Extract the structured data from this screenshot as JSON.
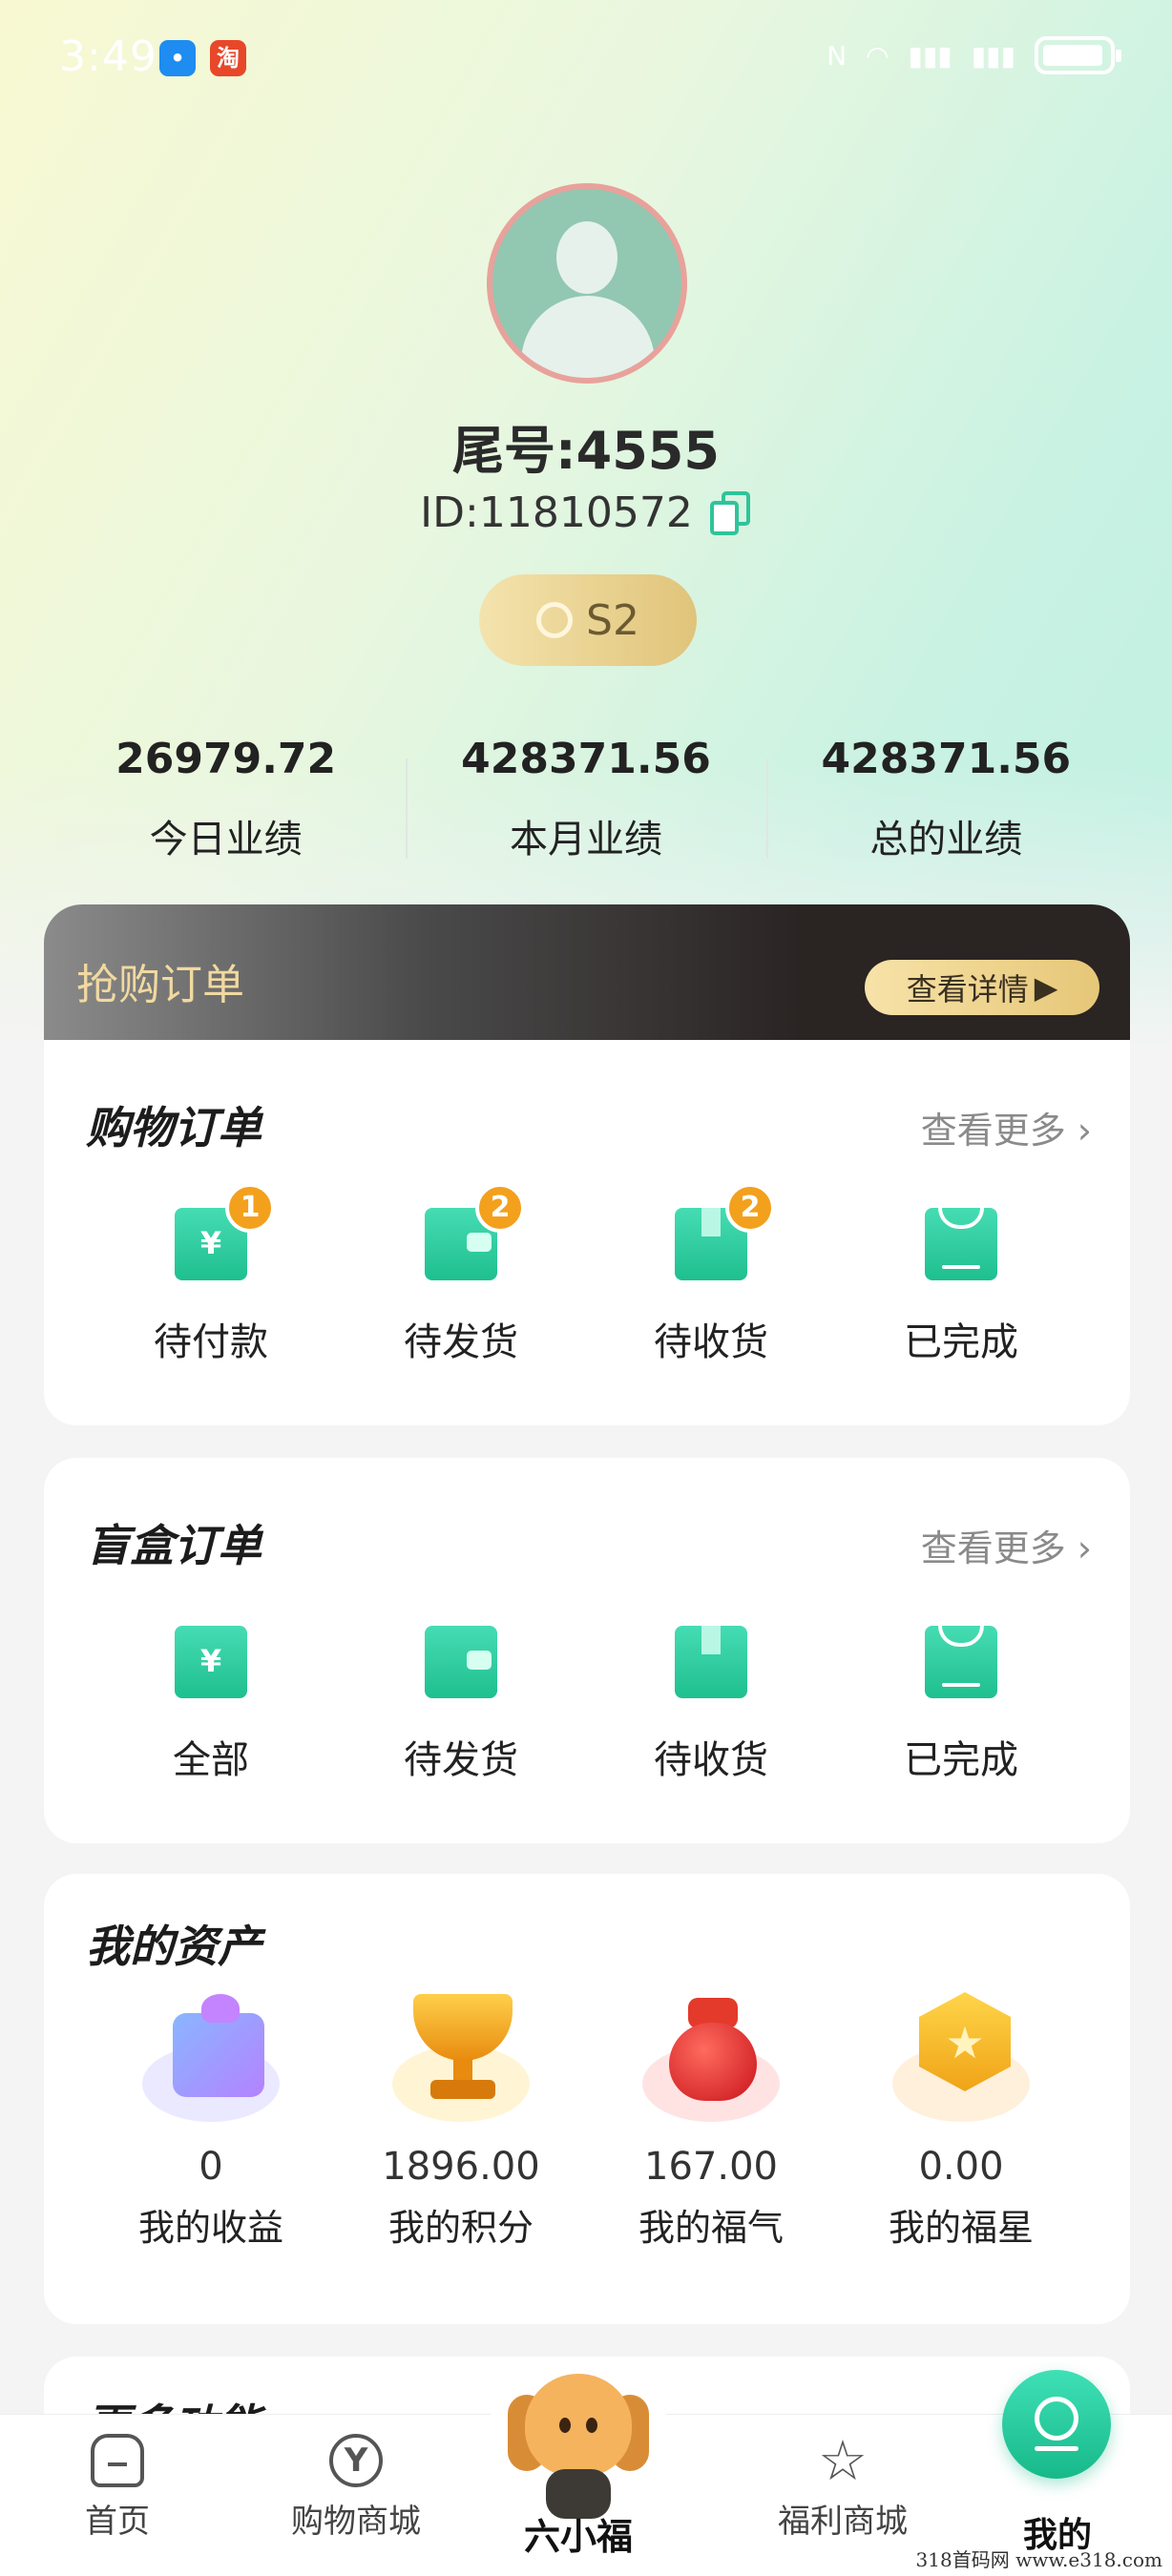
{
  "status_bar": {
    "time": "3:49",
    "apps": [
      "message-app-icon",
      "taobao-app-icon"
    ],
    "taobao_glyph": "淘",
    "signal": [
      "nfc-icon",
      "wifi-icon",
      "4g-signal-icon",
      "4g-signal-icon",
      "battery-icon"
    ]
  },
  "profile": {
    "nickname": "尾号:4555",
    "user_id": "ID:11810572",
    "level": "S2"
  },
  "stats": [
    {
      "value": "26979.72",
      "label": "今日业绩"
    },
    {
      "value": "428371.56",
      "label": "本月业绩"
    },
    {
      "value": "428371.56",
      "label": "总的业绩"
    }
  ],
  "flash_sale": {
    "title": "抢购订单",
    "button": "查看详情",
    "button_arrow": "▶"
  },
  "shopping_orders": {
    "title_a": "购物",
    "title_b": "订单",
    "more": "查看更多",
    "items": [
      {
        "label": "待付款",
        "badge": "1",
        "mark": "¥"
      },
      {
        "label": "待发货",
        "badge": "2"
      },
      {
        "label": "待收货",
        "badge": "2"
      },
      {
        "label": "已完成"
      }
    ]
  },
  "blindbox_orders": {
    "title_a": "盲盒",
    "title_b": "订单",
    "more": "查看更多",
    "items": [
      {
        "label": "全部",
        "mark": "¥"
      },
      {
        "label": "待发货"
      },
      {
        "label": "待收货"
      },
      {
        "label": "已完成"
      }
    ]
  },
  "assets": {
    "title_a": "我的",
    "title_b": "资产",
    "items": [
      {
        "value": "0",
        "label": "我的收益"
      },
      {
        "value": "1896.00",
        "label": "我的积分"
      },
      {
        "value": "167.00",
        "label": "我的福气"
      },
      {
        "value": "0.00",
        "label": "我的福星"
      }
    ]
  },
  "more_functions": {
    "title": "更多功能"
  },
  "bottom_nav": [
    {
      "label": "首页"
    },
    {
      "label": "购物商城"
    },
    {
      "label": "六小福"
    },
    {
      "label": "福利商城"
    },
    {
      "label": "我的"
    }
  ],
  "watermark": "318首码网  www.e318.com",
  "colors": {
    "accent": "#1fbf8f",
    "badge": "#f3a01d",
    "gold": "#e0c47a"
  }
}
